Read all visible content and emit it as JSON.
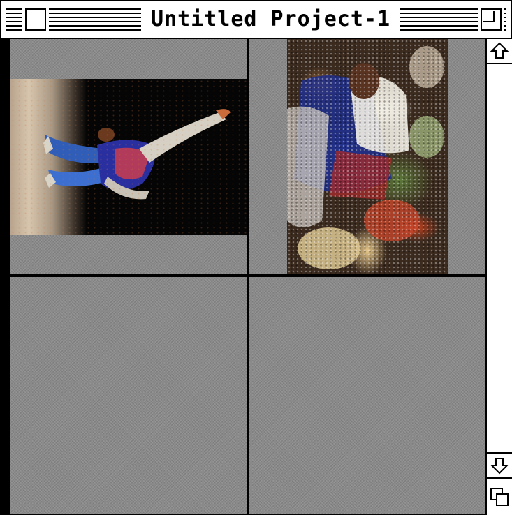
{
  "window": {
    "title": "Untitled Project-1"
  },
  "icons": {
    "close": "close-box-icon",
    "zoom": "zoom-box-icon",
    "scroll_up": "up-arrow-icon",
    "scroll_down": "down-arrow-icon",
    "grow": "size-box-icon"
  },
  "grid": {
    "cells": [
      {
        "id": "cell-1",
        "content": "photo"
      },
      {
        "id": "cell-2",
        "content": "photo"
      },
      {
        "id": "cell-3",
        "content": "empty"
      },
      {
        "id": "cell-4",
        "content": "empty"
      }
    ]
  },
  "colors": {
    "cell_background": "#8a8a8a",
    "divider": "#000000",
    "chrome": "#ffffff"
  }
}
